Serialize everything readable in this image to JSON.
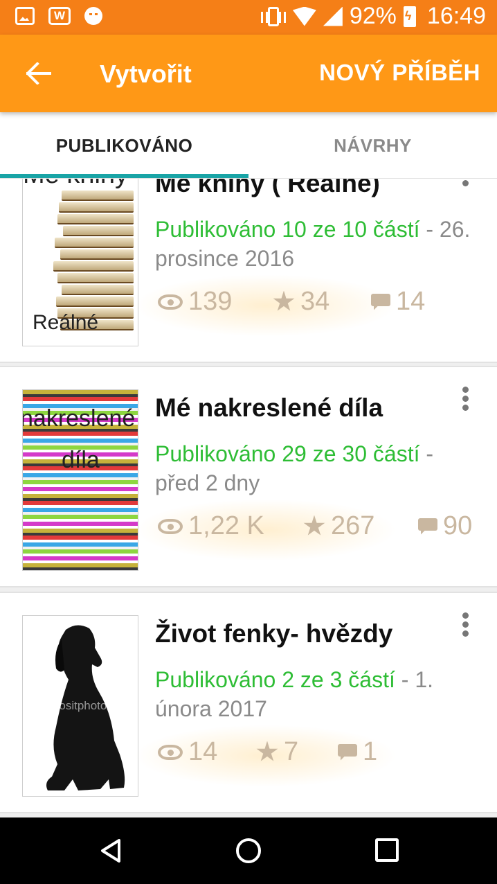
{
  "status_bar": {
    "battery": "92%",
    "time": "16:49",
    "icons": [
      "image-icon",
      "w-app-icon",
      "chat-icon",
      "vibrate-icon",
      "wifi-icon",
      "signal-icon",
      "battery-charging-icon"
    ]
  },
  "app_bar": {
    "title": "Vytvořit",
    "action": "NOVÝ PŘÍBĚH",
    "background": "#ff9816"
  },
  "tabs": [
    {
      "label": "PUBLIKOVÁNO",
      "selected": true
    },
    {
      "label": "NÁVRHY",
      "selected": false
    }
  ],
  "accent_color": "#19a4a6",
  "stories": [
    {
      "title": "Mé knihy ( Reálné)",
      "cover_text": "Mé knihy",
      "cover_subtext": "Reálné",
      "published": "Publikováno 10 ze 10 částí",
      "date": " - 26. prosince 2016",
      "views": "139",
      "votes": "34",
      "comments": "14"
    },
    {
      "title": "Mé nakreslené díla",
      "cover_text": "nakreslené",
      "cover_subtext": "díla",
      "published": "Publikováno 29 ze 30 částí",
      "date": " - před 2 dny",
      "views": "1,22 K",
      "votes": "267",
      "comments": "90"
    },
    {
      "title": "Život fenky- hvězdy",
      "cover_text": "depositphotos",
      "published": "Publikováno 2 ze 3 částí",
      "date": " - 1. února 2017",
      "views": "14",
      "votes": "7",
      "comments": "1"
    }
  ]
}
